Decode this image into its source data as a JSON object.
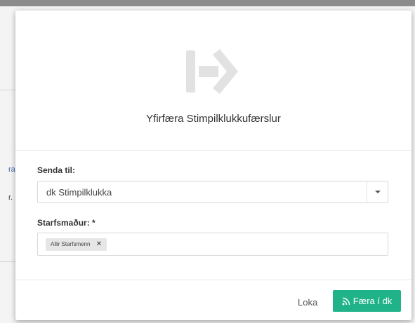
{
  "background": {
    "edge_text_1": "ra",
    "edge_text_2": "r."
  },
  "modal": {
    "header_icon": "arrow-right-from-bracket-icon",
    "title": "Yfirfæra Stimpilklukkufærslur",
    "send_to": {
      "label": "Senda til:",
      "value": "dk Stimpilklukka"
    },
    "employee": {
      "label": "Starfsmaður: *",
      "tags": [
        "Allir Starfsmenn"
      ],
      "remove_glyph": "✕"
    },
    "footer": {
      "close_label": "Loka",
      "submit_label": "Færa í dk",
      "submit_icon": "rss-icon",
      "accent": "#20b389"
    }
  }
}
